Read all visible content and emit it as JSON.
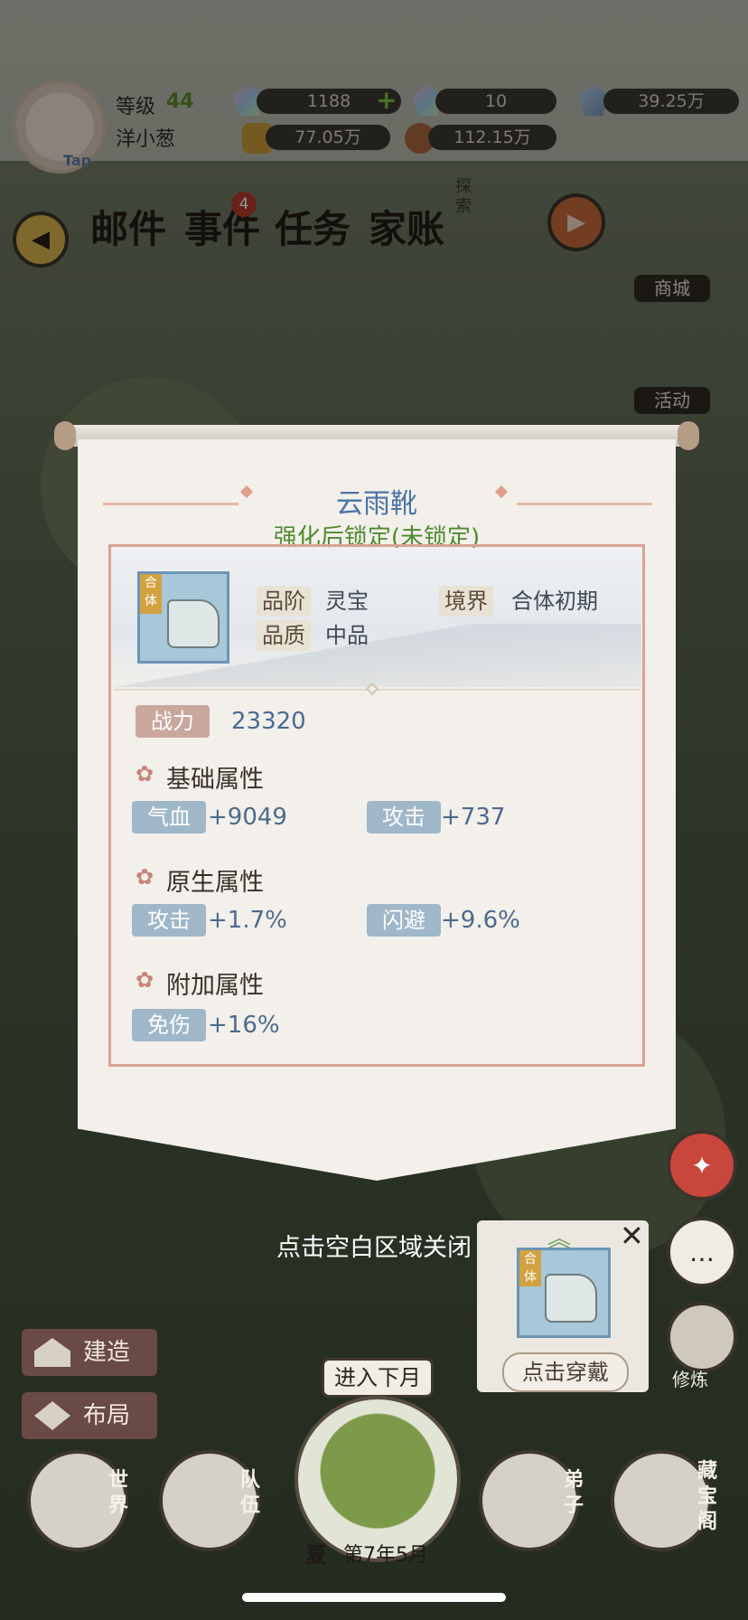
{
  "hud": {
    "level_label": "等级",
    "level_value": "44",
    "player_name": "洋小葱",
    "tap_label": "Tap",
    "resources": [
      {
        "name": "gem-icon",
        "value": "1188",
        "has_add": true
      },
      {
        "name": "crystal-icon",
        "value": "10"
      },
      {
        "name": "stone-icon",
        "value": "39.25万"
      },
      {
        "name": "gold-icon",
        "value": "77.05万"
      },
      {
        "name": "meat-icon",
        "value": "112.15万"
      }
    ],
    "add_symbol": "+"
  },
  "nav": {
    "items": [
      {
        "label": "邮件"
      },
      {
        "label": "事件",
        "badge": "4"
      },
      {
        "label": "任务"
      },
      {
        "label": "家账"
      }
    ],
    "explore_label": "探索",
    "side": [
      {
        "label": "商城"
      },
      {
        "label": "活动"
      }
    ]
  },
  "modal": {
    "title": "云雨靴",
    "subtitle": "强化后锁定(未锁定)",
    "item_tag": "合体",
    "grade_label": "品阶",
    "grade_value": "灵宝",
    "realm_label": "境界",
    "realm_value": "合体初期",
    "quality_label": "品质",
    "quality_value": "中品",
    "power_label": "战力",
    "power_value": "23320",
    "sections": [
      {
        "title": "基础属性",
        "stats": [
          {
            "label": "气血",
            "value": "+9049"
          },
          {
            "label": "攻击",
            "value": "+737"
          }
        ]
      },
      {
        "title": "原生属性",
        "stats": [
          {
            "label": "攻击",
            "value": "+1.7%"
          },
          {
            "label": "闪避",
            "value": "+9.6%"
          }
        ]
      },
      {
        "title": "附加属性",
        "stats": [
          {
            "label": "免伤",
            "value": "+16%"
          }
        ]
      }
    ],
    "section_icon": "✿"
  },
  "close_hint": "点击空白区域关闭",
  "equip_popup": {
    "tag": "合体",
    "button_label": "点击穿戴",
    "close_symbol": "✕",
    "up_symbol": "︽"
  },
  "bottom": {
    "build_label": "建造",
    "layout_label": "布局",
    "next_month_label": "进入下月",
    "season": "夏",
    "date": "第7年5月",
    "world_label": "世界",
    "team_label": "队伍",
    "disciple_label": "弟子",
    "treasure_label": "藏宝阁",
    "cultivate_label": "修炼",
    "chat_symbol": "…"
  }
}
